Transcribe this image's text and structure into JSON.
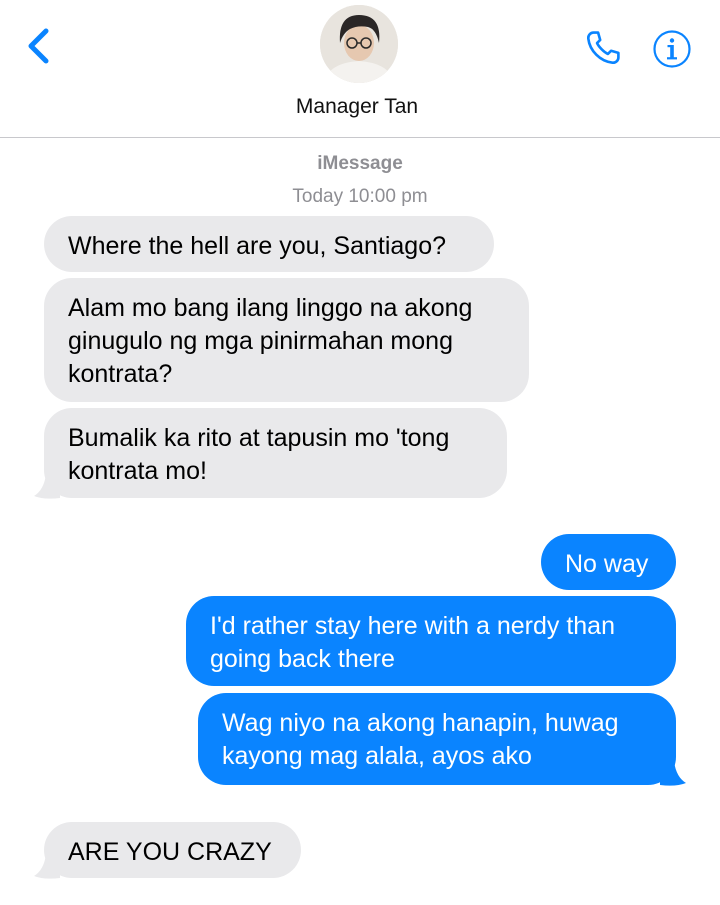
{
  "header": {
    "contact_name": "Manager Tan",
    "back_icon": "chevron-left-icon",
    "call_icon": "phone-icon",
    "info_icon": "info-icon"
  },
  "conversation": {
    "service": "iMessage",
    "timestamp": "Today 10:00 pm"
  },
  "messages": [
    {
      "direction": "incoming",
      "text": "Where the hell are you, Santiago?"
    },
    {
      "direction": "incoming",
      "text": "Alam mo bang ilang linggo na akong\nginugulo ng mga pinirmahan mong\nkontrata?"
    },
    {
      "direction": "incoming",
      "text": "Bumalik ka rito at tapusin mo 'tong\nkontrata mo!"
    },
    {
      "direction": "outgoing",
      "text": "No way"
    },
    {
      "direction": "outgoing",
      "text": "I'd rather stay here with a nerdy than\ngoing back there"
    },
    {
      "direction": "outgoing",
      "text": "Wag niyo na akong hanapin, huwag\nkayong mag alala, ayos ako"
    },
    {
      "direction": "incoming",
      "text": "ARE YOU CRAZY"
    }
  ],
  "colors": {
    "accent": "#0a84ff",
    "incoming_bubble": "#e9e9eb",
    "secondary_text": "#8e8e93"
  }
}
